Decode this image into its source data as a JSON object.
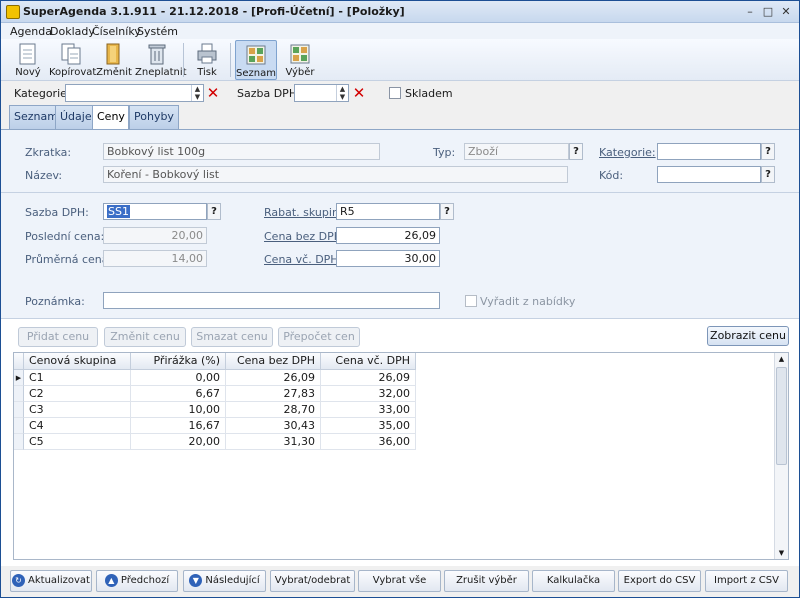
{
  "window": {
    "title": "SuperAgenda 3.1.911 - 21.12.2018 - [Profi-Účetní] - [Položky]",
    "controls": [
      "–",
      "□",
      "✕"
    ]
  },
  "menu": [
    "Agenda",
    "Doklady",
    "Číselníky",
    "Systém"
  ],
  "toolbar": {
    "new": "Nový",
    "copy": "Kopírovat",
    "edit": "Změnit",
    "invalidate": "Zneplatnit",
    "print": "Tisk",
    "list": "Seznam",
    "select": "Výběr"
  },
  "filter": {
    "category_label": "Kategorie:",
    "category_value": "",
    "vat_label": "Sazba DPH:",
    "vat_value": "",
    "stock_label": "Skladem"
  },
  "tabs": [
    "Seznam",
    "Údaje",
    "Ceny",
    "Pohyby"
  ],
  "active_tab": "Ceny",
  "form": {
    "zkratka_label": "Zkratka:",
    "zkratka_value": "Bobkový list 100g",
    "nazev_label": "Název:",
    "nazev_value": "Koření - Bobkový list",
    "typ_label": "Typ:",
    "typ_value": "Zboží",
    "kategorie_label": "Kategorie:",
    "kategorie_value": "",
    "kod_label": "Kód:",
    "kod_value": "",
    "sazba_label": "Sazba DPH:",
    "sazba_value": "SS1",
    "posledni_label": "Poslední cena:",
    "posledni_value": "20,00",
    "prumerna_label": "Průměrná cena:",
    "prumerna_value": "14,00",
    "rabat_label": "Rabat. skupina:",
    "rabat_value": "R5",
    "bezdph_label": "Cena bez DPH:",
    "bezdph_value": "26,09",
    "vcdph_label": "Cena vč. DPH:",
    "vcdph_value": "30,00",
    "poznamka_label": "Poznámka:",
    "poznamka_value": "",
    "vyradit_label": "Vyřadit z nabídky",
    "help": "?"
  },
  "actions": {
    "add": "Přidat cenu",
    "change": "Změnit cenu",
    "delete": "Smazat cenu",
    "recalc": "Přepočet cen",
    "show": "Zobrazit cenu"
  },
  "grid": {
    "columns": [
      "Cenová skupina",
      "Přirážka (%)",
      "Cena bez DPH",
      "Cena vč. DPH"
    ],
    "rows": [
      [
        "C1",
        "0,00",
        "26,09",
        "26,09"
      ],
      [
        "C2",
        "6,67",
        "27,83",
        "32,00"
      ],
      [
        "C3",
        "10,00",
        "28,70",
        "33,00"
      ],
      [
        "C4",
        "16,67",
        "30,43",
        "35,00"
      ],
      [
        "C5",
        "20,00",
        "31,30",
        "36,00"
      ]
    ]
  },
  "bottom": {
    "refresh": "Aktualizovat",
    "prev": "Předchozí",
    "next": "Následující",
    "select_toggle": "Vybrat/odebrat",
    "select_all": "Vybrat vše",
    "cancel_selection": "Zrušit výběr",
    "calculator": "Kalkulačka",
    "export_csv": "Export do CSV",
    "import_csv": "Import z CSV"
  },
  "colors": {
    "accent": "#3a6ec7",
    "delete": "#d20000",
    "panel": "#eef3fa"
  }
}
